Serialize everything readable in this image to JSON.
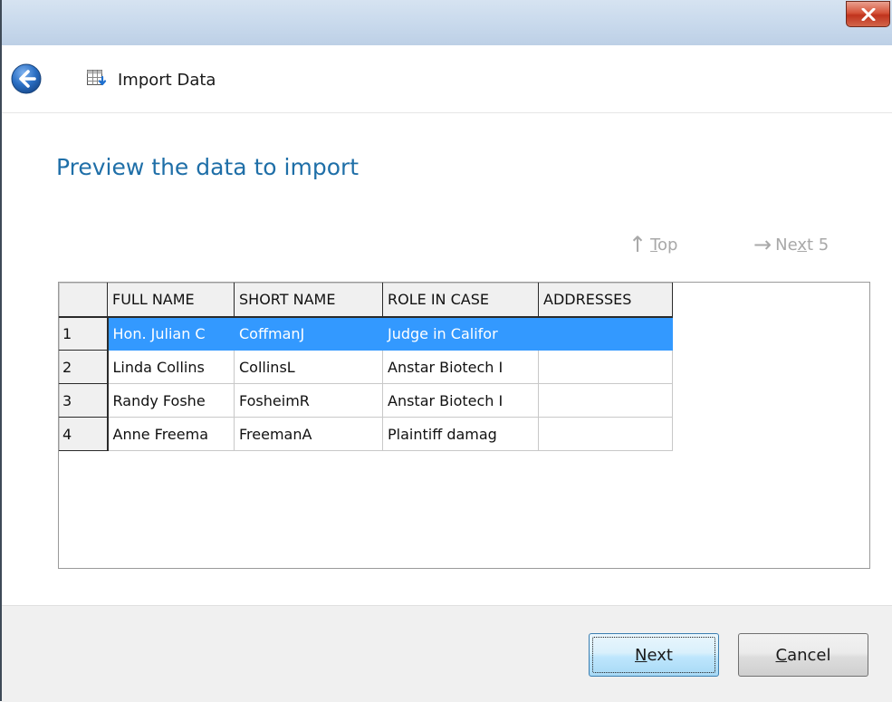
{
  "window": {
    "close_label": "✕"
  },
  "navbar": {
    "title": "Import Data"
  },
  "page": {
    "heading": "Preview the data to import"
  },
  "nav_links": {
    "top": {
      "arrow": "↑",
      "mnemonic": "T",
      "rest": "op"
    },
    "next5": {
      "arrow": "→",
      "pre": "Ne",
      "mnemonic": "x",
      "rest": "t 5"
    }
  },
  "grid": {
    "columns": [
      "FULL NAME",
      "SHORT NAME",
      "ROLE IN CASE",
      "ADDRESSES"
    ],
    "rows": [
      {
        "num": "1",
        "full_name": "Hon. Julian C",
        "short_name": "CoffmanJ",
        "role": "Judge in Califor",
        "addresses": ""
      },
      {
        "num": "2",
        "full_name": "Linda Collins",
        "short_name": "CollinsL",
        "role": "Anstar Biotech I",
        "addresses": ""
      },
      {
        "num": "3",
        "full_name": "Randy Foshe",
        "short_name": "FosheimR",
        "role": "Anstar Biotech I",
        "addresses": ""
      },
      {
        "num": "4",
        "full_name": "Anne Freema",
        "short_name": "FreemanA",
        "role": "Plaintiff damag",
        "addresses": ""
      }
    ],
    "selected_row": 1
  },
  "buttons": {
    "next": {
      "mnemonic": "N",
      "rest": "ext"
    },
    "cancel": {
      "mnemonic": "C",
      "rest": "ancel"
    }
  },
  "colors": {
    "accent_heading": "#1f6fa8",
    "selection": "#3399ff",
    "close_red": "#c0331d",
    "back_blue": "#2a6fc4"
  },
  "icons": {
    "back": "back-arrow-icon",
    "wizard": "import-table-icon",
    "close": "close-icon"
  }
}
